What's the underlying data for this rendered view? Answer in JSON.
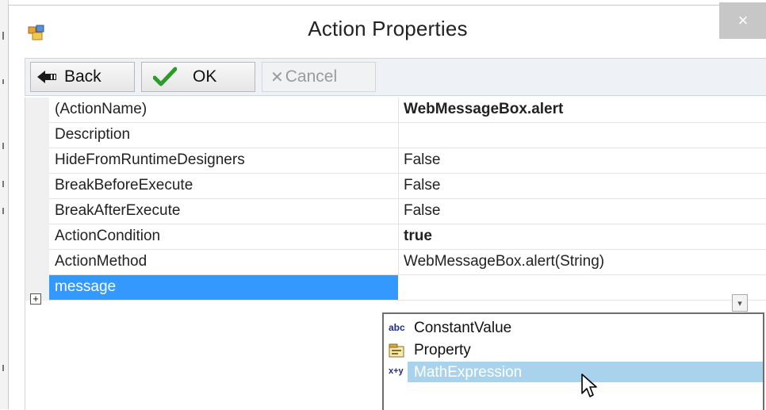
{
  "window": {
    "title": "Action Properties",
    "close_glyph": "×",
    "icon": "app-window-icon"
  },
  "toolbar": {
    "back_label": "Back",
    "ok_label": "OK",
    "cancel_label": "Cancel",
    "back_icon": "back-arrow-icon",
    "ok_icon": "checkmark-icon",
    "cancel_icon": "x-icon"
  },
  "properties": [
    {
      "name": "(ActionName)",
      "value": "WebMessageBox.alert",
      "bold": true
    },
    {
      "name": "Description",
      "value": "",
      "bold": false
    },
    {
      "name": "HideFromRuntimeDesigners",
      "value": "False",
      "bold": false
    },
    {
      "name": "BreakBeforeExecute",
      "value": "False",
      "bold": false
    },
    {
      "name": "BreakAfterExecute",
      "value": "False",
      "bold": false
    },
    {
      "name": "ActionCondition",
      "value": "true",
      "bold": true
    },
    {
      "name": "ActionMethod",
      "value": "WebMessageBox.alert(String)",
      "bold": false
    }
  ],
  "message_row": {
    "name": "message",
    "expander": "⊞",
    "dropdown_glyph": "⌄"
  },
  "dropdown": {
    "items": [
      {
        "label": "ConstantValue",
        "icon_text": "abc",
        "selected": false
      },
      {
        "label": "Property",
        "icon_text": "",
        "selected": false
      },
      {
        "label": "MathExpression",
        "icon_text": "x+y",
        "selected": true
      }
    ]
  },
  "colors": {
    "selection": "#3399ff",
    "list_highlight": "#a9d3ec",
    "toolbar_bg": "#eef1f5"
  }
}
